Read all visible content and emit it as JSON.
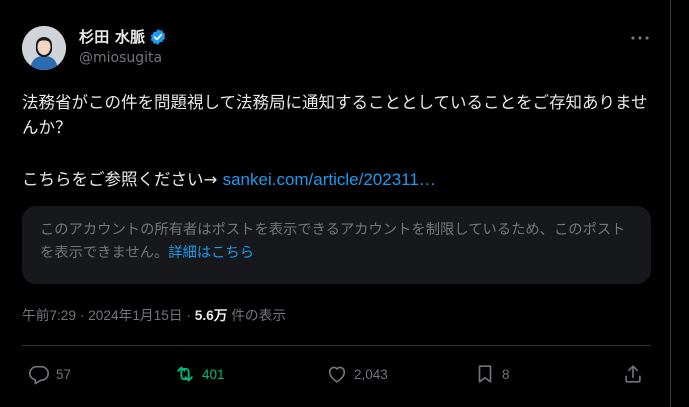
{
  "tweet": {
    "author": {
      "display_name": "杉田 水脈",
      "handle": "@miosugita"
    },
    "text_line1": "法務省がこの件を問題視して法務局に通知することとしていることをご存知ありませんか？",
    "link_prefix": "こちらをご参照ください→ ",
    "link_text": "sankei.com/article/202311…",
    "notice_text": "このアカウントの所有者はポストを表示できるアカウントを制限しているため、このポストを表示できません。",
    "notice_link": "詳細はこちら",
    "timestamp": "午前7:29 · 2024年1月15日 · ",
    "views_count": "5.6万",
    "views_label": " 件の表示"
  },
  "actions": {
    "replies": "57",
    "reposts": "401",
    "likes": "2,043",
    "bookmarks": "8"
  },
  "colors": {
    "background": "#000000",
    "text": "#e7e9ea",
    "muted": "#71767b",
    "link": "#1d9bf0",
    "repost_active": "#00ba7c",
    "verified": "#1d9bf0"
  },
  "icons": [
    "avatar",
    "verified-badge-icon",
    "more-icon",
    "reply-icon",
    "repost-icon",
    "like-icon",
    "bookmark-icon",
    "share-icon"
  ]
}
